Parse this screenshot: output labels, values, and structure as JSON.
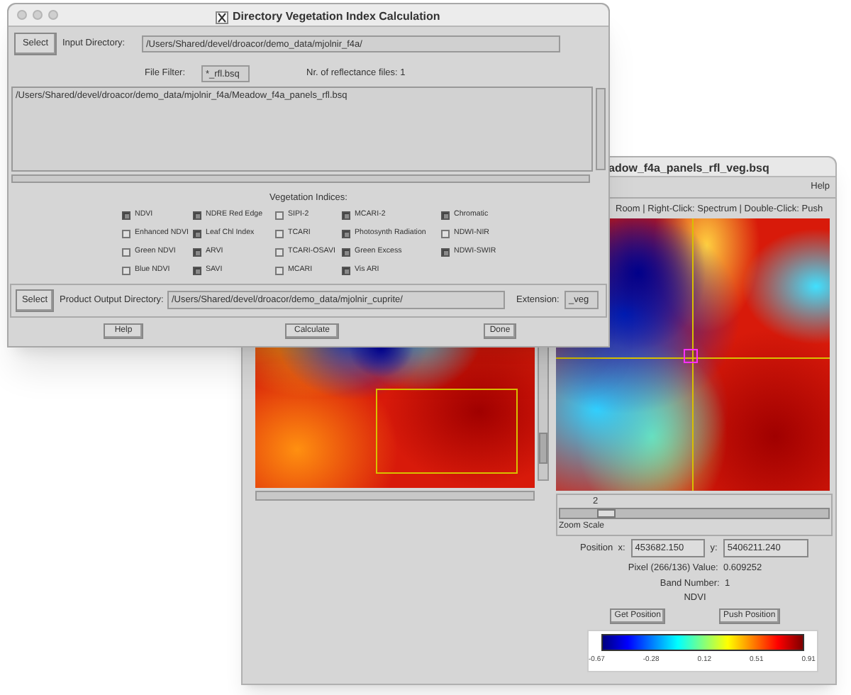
{
  "front_window": {
    "title": "Directory Vegetation Index Calculation",
    "input_directory": {
      "button": "Select",
      "label": "Input Directory:",
      "value": "/Users/Shared/devel/droacor/demo_data/mjolnir_f4a/"
    },
    "file_filter": {
      "label": "File Filter:",
      "value": "*_rfl.bsq"
    },
    "reflectance_count": "Nr. of reflectance files: 1",
    "file_list": [
      "/Users/Shared/devel/droacor/demo_data/mjolnir_f4a/Meadow_f4a_panels_rfl.bsq"
    ],
    "indices_label": "Vegetation Indices:",
    "indices": [
      {
        "label": "NDVI",
        "checked": true
      },
      {
        "label": "NDRE Red Edge",
        "checked": true
      },
      {
        "label": "SIPI-2",
        "checked": false
      },
      {
        "label": "MCARI-2",
        "checked": true
      },
      {
        "label": "Chromatic",
        "checked": true
      },
      {
        "label": "Enhanced NDVI",
        "checked": false
      },
      {
        "label": "Leaf Chl Index",
        "checked": true
      },
      {
        "label": "TCARI",
        "checked": false
      },
      {
        "label": "Photosynth Radiation",
        "checked": true
      },
      {
        "label": "NDWI-NIR",
        "checked": false
      },
      {
        "label": "Green NDVI",
        "checked": false
      },
      {
        "label": "ARVI",
        "checked": true
      },
      {
        "label": "TCARI-OSAVI",
        "checked": false
      },
      {
        "label": "Green Excess",
        "checked": true
      },
      {
        "label": "NDWI-SWIR",
        "checked": true
      },
      {
        "label": "Blue NDVI",
        "checked": false
      },
      {
        "label": "SAVI",
        "checked": true
      },
      {
        "label": "MCARI",
        "checked": false
      },
      {
        "label": "Vis ARI",
        "checked": true
      }
    ],
    "output_directory": {
      "button": "Select",
      "label": "Product Output Directory:",
      "value": "/Users/Shared/devel/droacor/demo_data/mjolnir_cuprite/"
    },
    "extension": {
      "label": "Extension:",
      "value": "_veg"
    },
    "buttons": [
      "Help",
      "Calculate",
      "Done"
    ]
  },
  "back_window": {
    "title": "adow_f4a_panels_rfl_veg.bsq",
    "menu": [
      "Help"
    ],
    "status": "Room | Right-Click: Spectrum | Double-Click: Push",
    "zoom": {
      "value": "2",
      "level": 0.15,
      "label": "Zoom Scale"
    },
    "position": {
      "x_label": "Position  x:",
      "x_value": "453682.150",
      "y_label": "y:",
      "y_value": "5406211.240"
    },
    "pixel": "Pixel (266/136) Value:  0.609252",
    "band": "Band Number:  1",
    "index_name": "NDVI",
    "buttons": [
      "Get Position",
      "Push Position"
    ],
    "colorbar_ticks": [
      "-0.67",
      "-0.28",
      "0.12",
      "0.51",
      "0.91"
    ]
  }
}
